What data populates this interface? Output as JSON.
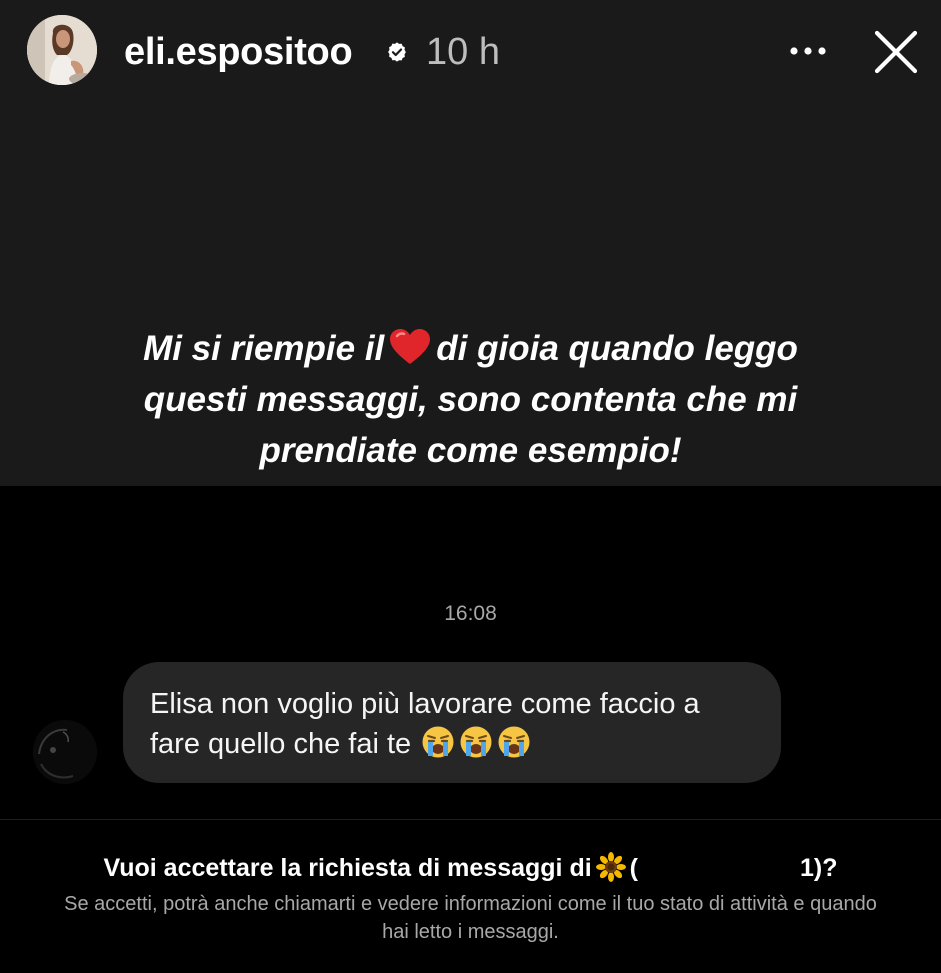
{
  "header": {
    "username": "eli.espositoo",
    "time": "10 h",
    "verified_icon": "verified-badge-icon",
    "more_icon": "more-options-icon",
    "close_icon": "close-icon"
  },
  "story": {
    "caption_before_heart": "Mi si riempie il",
    "caption_after_heart": "di gioia quando leggo",
    "caption_line2": "questi messaggi, sono contenta che mi",
    "caption_line3": "prendiate come esempio!",
    "heart_icon": "red-heart-emoji"
  },
  "chat": {
    "timestamp": "16:08",
    "message": "Elisa non voglio più lavorare come faccio a\nfare quello che fai te",
    "message_emojis": [
      "loudly-crying-face",
      "loudly-crying-face",
      "loudly-crying-face"
    ]
  },
  "request": {
    "title_prefix": "Vuoi accettare la richiesta di messaggi di",
    "title_open": "(",
    "title_suffix": "1)?",
    "subtitle": "Se accetti, potrà anche chiamarti e vedere informazioni come il tuo stato di attività e quando hai letto i messaggi."
  },
  "colors": {
    "story_bg": "#1a1a1b",
    "chat_bg": "#000000",
    "bubble_bg": "#262626",
    "muted_text": "#a8a8a8",
    "heart": "#e0252b"
  }
}
